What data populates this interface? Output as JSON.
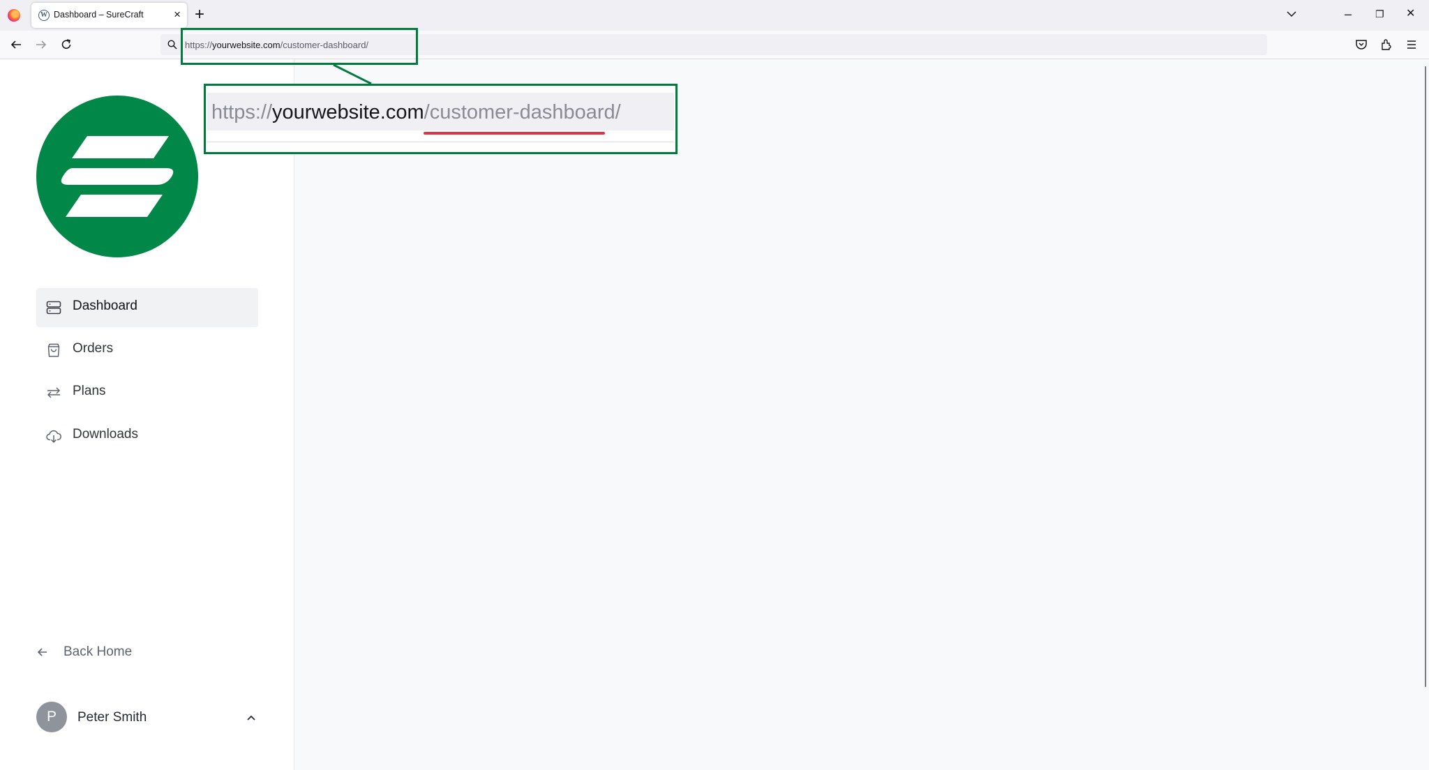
{
  "browser": {
    "tab_title": "Dashboard – SureCraft",
    "tab_close": "×",
    "new_tab": "+",
    "url_scheme": "https://",
    "url_host": "yourwebsite.com",
    "url_path": "/customer-dashboard/",
    "window_controls": {
      "minimize": "–",
      "restore": "❐",
      "close": "✕"
    }
  },
  "annotation": {
    "zoom_scheme": "https://",
    "zoom_host": "yourwebsite.com",
    "zoom_path": "/customer-dashboard/",
    "highlight_color": "#017a40",
    "underline_color": "#dc3545"
  },
  "brand": {
    "logo_color": "#018848"
  },
  "sidebar": {
    "items": [
      {
        "label": "Dashboard",
        "icon": "server-stack-icon",
        "active": true
      },
      {
        "label": "Orders",
        "icon": "shopping-bag-icon",
        "active": false
      },
      {
        "label": "Plans",
        "icon": "arrows-repeat-icon",
        "active": false
      },
      {
        "label": "Downloads",
        "icon": "cloud-download-icon",
        "active": false
      }
    ],
    "back_home": "Back Home",
    "user": {
      "initial": "P",
      "name": "Peter Smith"
    }
  }
}
